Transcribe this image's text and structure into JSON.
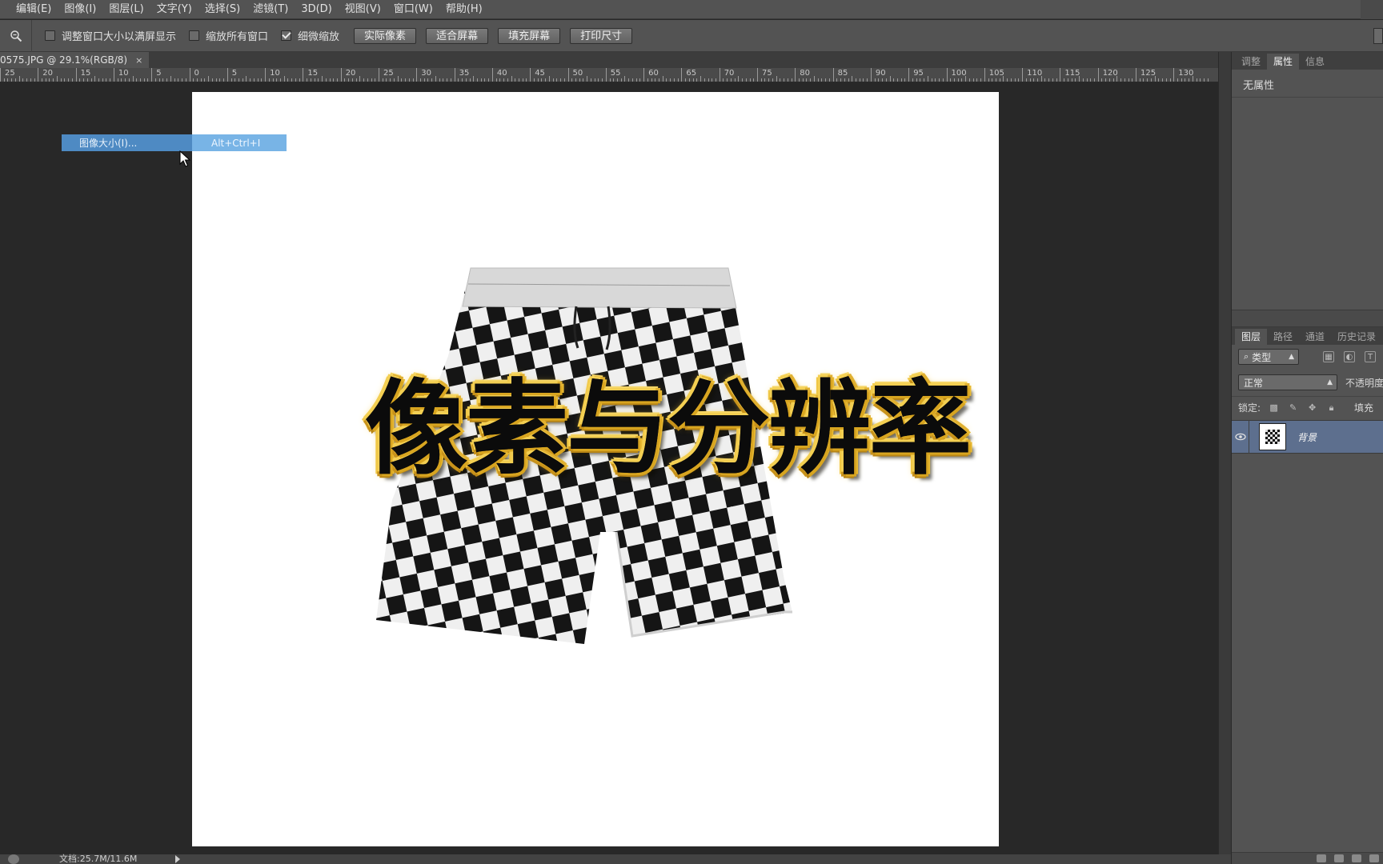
{
  "menu": [
    "编辑(E)",
    "图像(I)",
    "图层(L)",
    "文字(Y)",
    "选择(S)",
    "滤镜(T)",
    "3D(D)",
    "视图(V)",
    "窗口(W)",
    "帮助(H)"
  ],
  "options": {
    "checks": [
      {
        "label": "调整窗口大小以满屏显示",
        "checked": false
      },
      {
        "label": "缩放所有窗口",
        "checked": false
      },
      {
        "label": "细微缩放",
        "checked": true
      }
    ],
    "buttons": [
      "实际像素",
      "适合屏幕",
      "填充屏幕",
      "打印尺寸"
    ]
  },
  "document_tab": {
    "title": "0575.JPG @ 29.1%(RGB/8)",
    "close": "×"
  },
  "ruler_labels": [
    "25",
    "20",
    "15",
    "10",
    "5",
    "0",
    "5",
    "10",
    "15",
    "20",
    "25",
    "30",
    "35",
    "40",
    "45",
    "50",
    "55",
    "60",
    "65",
    "70",
    "75",
    "80",
    "85",
    "90",
    "95",
    "100",
    "105",
    "110",
    "115",
    "120",
    "125",
    "130"
  ],
  "context_item": {
    "label": "图像大小(I)...",
    "shortcut": "Alt+Ctrl+I"
  },
  "overlay_title": "像素与分辨率",
  "status": {
    "doc_info": "文档:25.7M/11.6M"
  },
  "properties_panel": {
    "tabs": [
      "调整",
      "属性",
      "信息"
    ],
    "active_tab": 1,
    "no_properties": "无属性"
  },
  "layers_panel": {
    "tabs": [
      "图层",
      "路径",
      "通道",
      "历史记录"
    ],
    "active_tab": 0,
    "filter_type": "类型",
    "blend_mode": "正常",
    "opacity_label": "不透明度",
    "lock_label": "锁定:",
    "fill_label": "填充",
    "layers": [
      {
        "name": "背景",
        "visible": true,
        "selected": true
      }
    ]
  },
  "colors": {
    "accent_selection": "#78b4e6",
    "layer_selected": "#5d6f8e",
    "title_gold": "#e8b932"
  }
}
